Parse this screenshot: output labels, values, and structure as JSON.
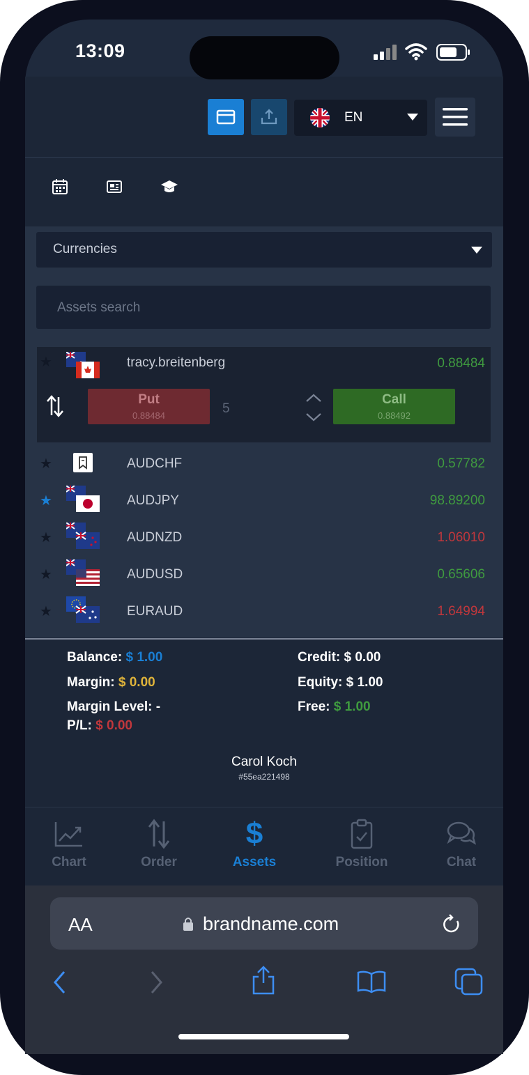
{
  "status_bar": {
    "time": "13:09"
  },
  "header": {
    "language": "EN"
  },
  "asset_filter": {
    "category": "Currencies",
    "search_placeholder": "Assets search"
  },
  "selected_asset": {
    "name": "tracy.breitenberg",
    "price": "0.88484",
    "put_label": "Put",
    "put_price": "0.88484",
    "amount": "5",
    "call_label": "Call",
    "call_price": "0.88492"
  },
  "assets": [
    {
      "name": "AUDCHF",
      "price": "0.57782",
      "favorite": false,
      "trend": "up"
    },
    {
      "name": "AUDJPY",
      "price": "98.89200",
      "favorite": true,
      "trend": "up"
    },
    {
      "name": "AUDNZD",
      "price": "1.06010",
      "favorite": false,
      "trend": "down"
    },
    {
      "name": "AUDUSD",
      "price": "0.65606",
      "favorite": false,
      "trend": "up"
    },
    {
      "name": "EURAUD",
      "price": "1.64994",
      "favorite": false,
      "trend": "down"
    }
  ],
  "account": {
    "balance_label": "Balance:",
    "balance_value": "$ 1.00",
    "credit_label": "Credit:",
    "credit_value": "$ 0.00",
    "margin_label": "Margin:",
    "margin_value": "$ 0.00",
    "equity_label": "Equity:",
    "equity_value": "$ 1.00",
    "margin_level_label": "Margin Level:",
    "margin_level_value": "-",
    "free_label": "Free:",
    "free_value": "$ 1.00",
    "pl_label": "P/L:",
    "pl_value": "$ 0.00"
  },
  "user": {
    "name": "Carol Koch",
    "id": "#55ea221498"
  },
  "bottom_nav": [
    {
      "label": "Chart",
      "icon": "chart-icon",
      "active": false
    },
    {
      "label": "Order",
      "icon": "order-arrows-icon",
      "active": false
    },
    {
      "label": "Assets",
      "icon": "dollar-icon",
      "active": true
    },
    {
      "label": "Position",
      "icon": "clipboard-check-icon",
      "active": false
    },
    {
      "label": "Chat",
      "icon": "chat-bubbles-icon",
      "active": false
    }
  ],
  "browser": {
    "text_size_label": "AA",
    "url": "brandname.com"
  },
  "colors": {
    "accent": "#1a7fd4",
    "up": "#3f9a3f",
    "down": "#c0373c",
    "margin": "#e0b43a",
    "background": "#1f2a3d"
  }
}
